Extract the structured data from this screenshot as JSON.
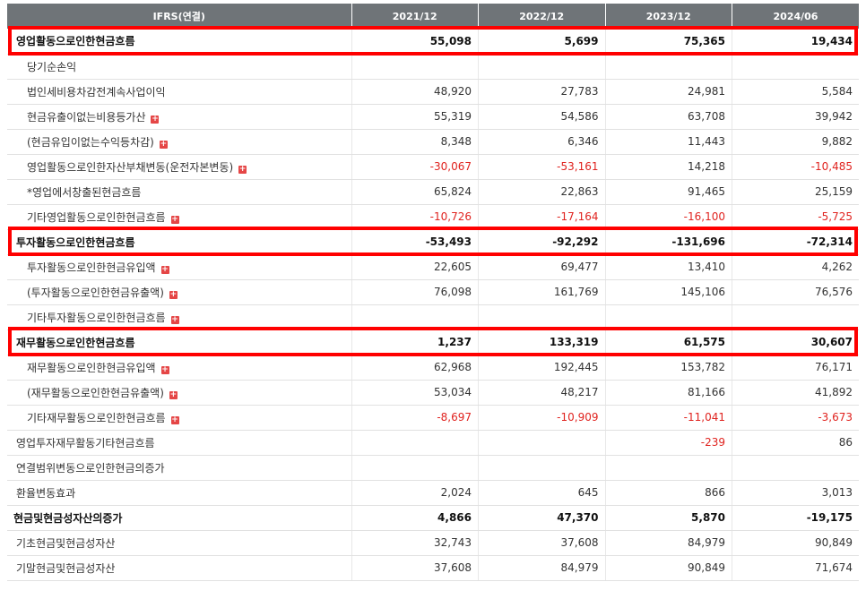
{
  "columns": [
    "IFRS(연결)",
    "2021/12",
    "2022/12",
    "2023/12",
    "2024/06"
  ],
  "rows": [
    {
      "label": "영업활동으로인한현금흐름",
      "kind": "main",
      "expand": false,
      "values": [
        "55,098",
        "5,699",
        "75,365",
        "19,434"
      ]
    },
    {
      "label": "당기순손익",
      "kind": "sub",
      "expand": false,
      "values": [
        "",
        "",
        "",
        ""
      ]
    },
    {
      "label": "법인세비용차감전계속사업이익",
      "kind": "sub",
      "expand": false,
      "values": [
        "48,920",
        "27,783",
        "24,981",
        "5,584"
      ]
    },
    {
      "label": "현금유출이없는비용등가산",
      "kind": "sub",
      "expand": true,
      "values": [
        "55,319",
        "54,586",
        "63,708",
        "39,942"
      ]
    },
    {
      "label": "(현금유입이없는수익등차감)",
      "kind": "sub",
      "expand": true,
      "values": [
        "8,348",
        "6,346",
        "11,443",
        "9,882"
      ]
    },
    {
      "label": "영업활동으로인한자산부채변동(운전자본변동)",
      "kind": "sub",
      "expand": true,
      "values": [
        "-30,067",
        "-53,161",
        "14,218",
        "-10,485"
      ]
    },
    {
      "label": "*영업에서창출된현금흐름",
      "kind": "sub",
      "expand": false,
      "values": [
        "65,824",
        "22,863",
        "91,465",
        "25,159"
      ]
    },
    {
      "label": "기타영업활동으로인한현금흐름",
      "kind": "sub",
      "expand": true,
      "values": [
        "-10,726",
        "-17,164",
        "-16,100",
        "-5,725"
      ]
    },
    {
      "label": "투자활동으로인한현금흐름",
      "kind": "main",
      "expand": false,
      "values": [
        "-53,493",
        "-92,292",
        "-131,696",
        "-72,314"
      ]
    },
    {
      "label": "투자활동으로인한현금유입액",
      "kind": "sub",
      "expand": true,
      "values": [
        "22,605",
        "69,477",
        "13,410",
        "4,262"
      ]
    },
    {
      "label": "(투자활동으로인한현금유출액)",
      "kind": "sub",
      "expand": true,
      "values": [
        "76,098",
        "161,769",
        "145,106",
        "76,576"
      ]
    },
    {
      "label": "기타투자활동으로인한현금흐름",
      "kind": "sub",
      "expand": true,
      "values": [
        "",
        "",
        "",
        ""
      ]
    },
    {
      "label": "재무활동으로인한현금흐름",
      "kind": "main",
      "expand": false,
      "values": [
        "1,237",
        "133,319",
        "61,575",
        "30,607"
      ]
    },
    {
      "label": "재무활동으로인한현금유입액",
      "kind": "sub",
      "expand": true,
      "values": [
        "62,968",
        "192,445",
        "153,782",
        "76,171"
      ]
    },
    {
      "label": "(재무활동으로인한현금유출액)",
      "kind": "sub",
      "expand": true,
      "values": [
        "53,034",
        "48,217",
        "81,166",
        "41,892"
      ]
    },
    {
      "label": "기타재무활동으로인한현금흐름",
      "kind": "sub",
      "expand": true,
      "values": [
        "-8,697",
        "-10,909",
        "-11,041",
        "-3,673"
      ]
    },
    {
      "label": "영업투자재무활동기타현금흐름",
      "kind": "top",
      "expand": false,
      "values": [
        "",
        "",
        "-239",
        "86"
      ]
    },
    {
      "label": "연결범위변동으로인한현금의증가",
      "kind": "top",
      "expand": false,
      "values": [
        "",
        "",
        "",
        ""
      ]
    },
    {
      "label": "환율변동효과",
      "kind": "top",
      "expand": false,
      "values": [
        "2,024",
        "645",
        "866",
        "3,013"
      ]
    },
    {
      "label": "현금및현금성자산의증가",
      "kind": "bold",
      "expand": false,
      "values": [
        "4,866",
        "47,370",
        "5,870",
        "-19,175"
      ]
    },
    {
      "label": "기초현금및현금성자산",
      "kind": "top",
      "expand": false,
      "values": [
        "32,743",
        "37,608",
        "84,979",
        "90,849"
      ]
    },
    {
      "label": "기말현금및현금성자산",
      "kind": "top",
      "expand": false,
      "values": [
        "37,608",
        "84,979",
        "90,849",
        "71,674"
      ]
    }
  ],
  "highlighted_rows": [
    0,
    8,
    12
  ],
  "colors": {
    "header_bg": "#6f7478",
    "negative": "#e0231f",
    "highlight": "#ff0000",
    "expand_icon": "#e54646"
  },
  "icons": {
    "expand": "plus-square-icon"
  }
}
